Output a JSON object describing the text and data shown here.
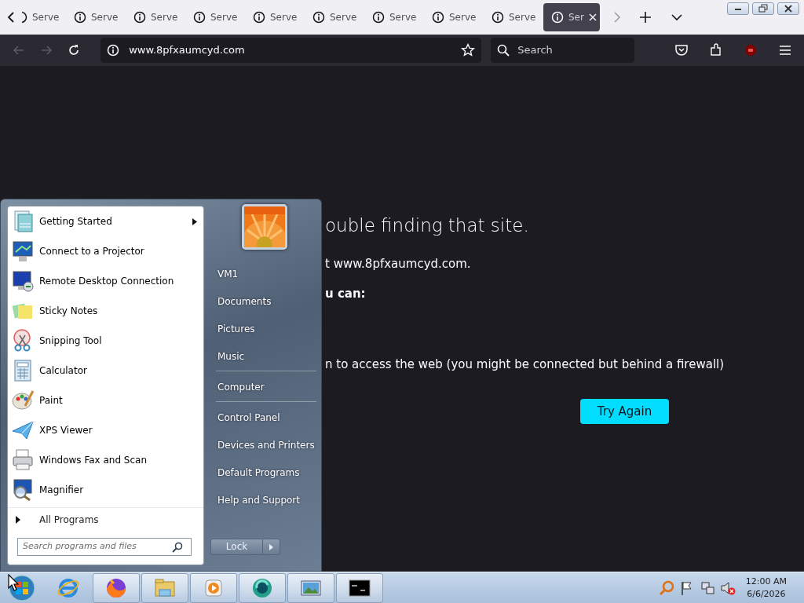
{
  "browser": {
    "tabs": [
      {
        "label": "Serve",
        "selected": false,
        "partial": true
      },
      {
        "label": "Serve",
        "selected": false,
        "partial": false
      },
      {
        "label": "Serve",
        "selected": false,
        "partial": false
      },
      {
        "label": "Serve",
        "selected": false,
        "partial": false
      },
      {
        "label": "Serve",
        "selected": false,
        "partial": false
      },
      {
        "label": "Serve",
        "selected": false,
        "partial": false
      },
      {
        "label": "Serve",
        "selected": false,
        "partial": false
      },
      {
        "label": "Serve",
        "selected": false,
        "partial": false
      },
      {
        "label": "Serve",
        "selected": false,
        "partial": false
      },
      {
        "label": "Ser",
        "selected": true,
        "partial": false
      }
    ],
    "nav_buttons": [
      {
        "kind": "back",
        "disabled": true
      },
      {
        "kind": "forward",
        "disabled": true
      },
      {
        "kind": "reload",
        "disabled": false
      }
    ],
    "address": {
      "url": "www.8pfxaumcyd.com"
    },
    "search": {
      "placeholder": "Search"
    }
  },
  "page": {
    "heading": "ouble finding that site.",
    "lines": [
      "t www.8pfxaumcyd.com.",
      "u can:",
      "n to access the web (you might be connected but behind a firewall)"
    ],
    "button": "Try Again"
  },
  "start_menu": {
    "programs": [
      {
        "label": "Getting Started",
        "submenu": true
      },
      {
        "label": "Connect to a Projector",
        "submenu": false
      },
      {
        "label": "Remote Desktop Connection",
        "submenu": false
      },
      {
        "label": "Sticky Notes",
        "submenu": false
      },
      {
        "label": "Snipping Tool",
        "submenu": false
      },
      {
        "label": "Calculator",
        "submenu": false
      },
      {
        "label": "Paint",
        "submenu": false
      },
      {
        "label": "XPS Viewer",
        "submenu": false
      },
      {
        "label": "Windows Fax and Scan",
        "submenu": false
      },
      {
        "label": "Magnifier",
        "submenu": false
      }
    ],
    "all_programs": "All Programs",
    "search": {
      "placeholder": "Search programs and files"
    },
    "places": [
      {
        "label": "VM1",
        "divider_before": false
      },
      {
        "label": "Documents",
        "divider_before": false
      },
      {
        "label": "Pictures",
        "divider_before": false
      },
      {
        "label": "Music",
        "divider_before": false
      },
      {
        "label": "Computer",
        "divider_before": true
      },
      {
        "label": "Control Panel",
        "divider_before": true
      },
      {
        "label": "Devices and Printers",
        "divider_before": false
      },
      {
        "label": "Default Programs",
        "divider_before": false
      },
      {
        "label": "Help and Support",
        "divider_before": false
      }
    ],
    "lock_button": "Lock"
  },
  "taskbar": {
    "clock": {
      "time": "12:00 AM",
      "date": "6/6/2026"
    }
  }
}
